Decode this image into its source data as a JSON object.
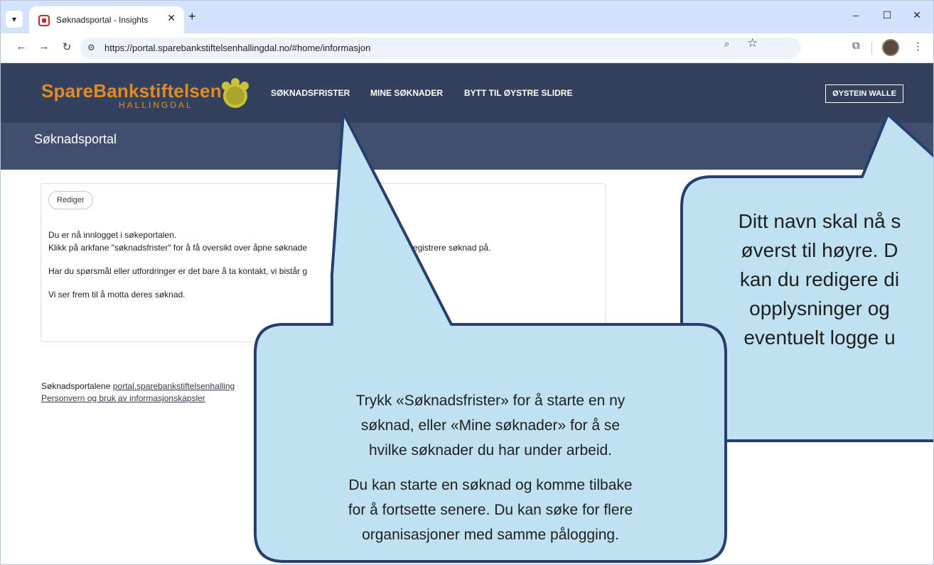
{
  "browser": {
    "tab_title": "Søknadsportal - Insights",
    "url": "https://portal.sparebankstiftelsenhallingdal.no/#home/informasjon",
    "icons": [
      "tab-search-icon",
      "favicon-icon",
      "close-icon",
      "new-tab-icon",
      "minimize-icon",
      "maximize-icon",
      "back-icon",
      "forward-icon",
      "reload-icon",
      "site-info-icon",
      "zoom-icon",
      "bookmark-star-icon",
      "extensions-icon",
      "profile-icon",
      "menu-icon"
    ]
  },
  "site": {
    "logo_main": "SpareBankstiftelsen",
    "logo_sub": "HALLINGDAL",
    "brand_color": "#e58a22",
    "header_color": "#33415c",
    "nav": [
      "SØKNADSFRISTER",
      "MINE SØKNADER",
      "BYTT TIL ØYSTRE SLIDRE"
    ],
    "user_button": "ØYSTEIN WALLE",
    "portal_title": "Søknadsportal"
  },
  "panel": {
    "edit_label": "Rediger",
    "lines": [
      "Du er nå innlogget i søkeportalen.",
      "Klikk på arkfane \"søknadsfrister\" for å få oversikt over åpne søknade",
      "Har du spørsmål eller utfordringer er det bare å ta kontakt, vi bistår g",
      "Vi ser frem til å motta deres søknad."
    ],
    "line2_tail": "u/dere vil registrere søknad på."
  },
  "footer": {
    "prefix": "Søknadsportalene ",
    "portal_link": "portal.sparebankstiftelsenhalling",
    "privacy_link": "Personvern og bruk av informasjonskapsler"
  },
  "callouts": {
    "fill_color": "#bfe1f2",
    "stroke_color": "#263f6e",
    "right_lines": [
      "Ditt navn skal nå s",
      "øverst til høyre. D",
      "kan du redigere di",
      "opplysninger og",
      "eventuelt logge u"
    ],
    "center_para1": [
      "Trykk «Søknadsfrister» for å starte en ny",
      "søknad, eller «Mine søknader» for å se",
      "hvilke søknader du har under arbeid."
    ],
    "center_para2": [
      "Du kan starte en søknad og komme tilbake",
      "for å fortsette senere. Du kan søke for flere",
      "organisasjoner med samme pålogging."
    ]
  }
}
